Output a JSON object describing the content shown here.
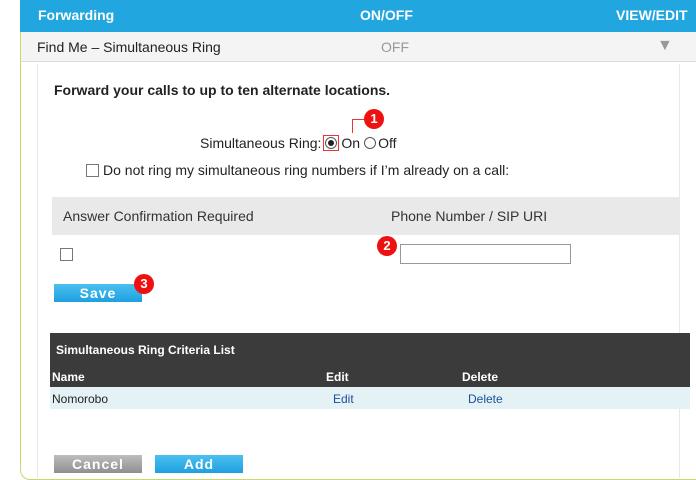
{
  "header": {
    "forwarding": "Forwarding",
    "onoff": "ON/OFF",
    "viewedit": "VIEW/EDIT"
  },
  "service": {
    "title": "Find Me – Simultaneous Ring",
    "status": "OFF",
    "arrow": "▼"
  },
  "intro": "Forward your calls to up to ten alternate locations.",
  "simultaneous_ring": {
    "label": "Simultaneous Ring:",
    "on_label": "On",
    "off_label": "Off",
    "selected": "On"
  },
  "dont_ring": {
    "label": "Do not ring my simultaneous ring numbers if I’m already on a call:",
    "checked": false
  },
  "columns": {
    "answer_conf": "Answer Confirmation Required",
    "phone": "Phone Number / SIP URI"
  },
  "row": {
    "answer_conf_checked": false,
    "phone_value": ""
  },
  "buttons": {
    "save": "Save",
    "cancel": "Cancel",
    "add": "Add"
  },
  "badges": {
    "one": "1",
    "two": "2",
    "three": "3"
  },
  "criteria": {
    "title": "Simultaneous Ring Criteria List",
    "headers": {
      "name": "Name",
      "edit": "Edit",
      "delete": "Delete"
    },
    "rows": [
      {
        "name": "Nomorobo",
        "edit": "Edit",
        "delete": "Delete"
      }
    ]
  },
  "colors": {
    "accent": "#22a6e0",
    "table_dark": "#3b3b3b",
    "row_bg": "#e4f1f5",
    "badge": "#e11111"
  }
}
